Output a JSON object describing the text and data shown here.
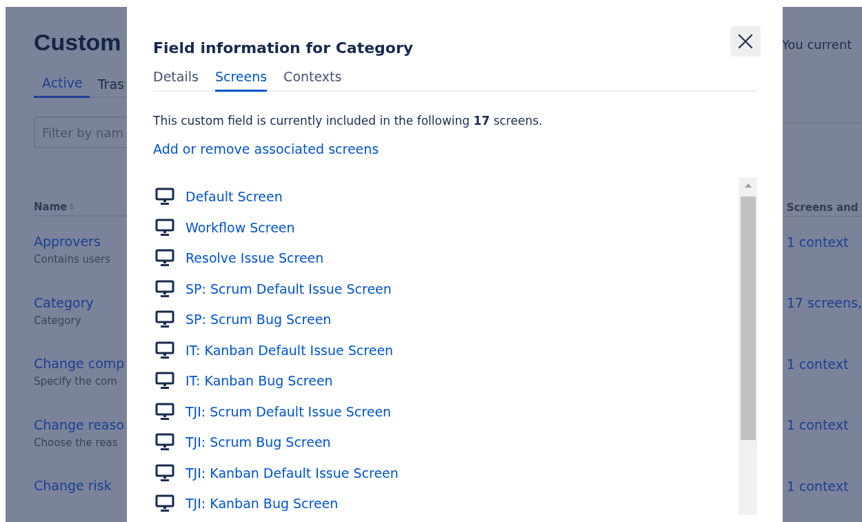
{
  "page": {
    "title": "Custom",
    "tabs": [
      {
        "label": "Active",
        "selected": true
      },
      {
        "label": "Tras",
        "selected": false
      }
    ],
    "filter": {
      "placeholder": "Filter by nam"
    },
    "notice": "You current",
    "table": {
      "columns": [
        "Name",
        "Screens and"
      ],
      "rows": [
        {
          "name": "Approvers",
          "description": "Contains users",
          "usage": "1 context"
        },
        {
          "name": "Category",
          "description": "Category",
          "usage": "17 screens,"
        },
        {
          "name": "Change comp",
          "description": "Specify the com",
          "usage": "1 context"
        },
        {
          "name": "Change reaso",
          "description": "Choose the reas",
          "usage": "1 context"
        },
        {
          "name": "Change risk",
          "usage": "1 context"
        }
      ]
    }
  },
  "dialog": {
    "title": "Field information for Category",
    "tabs": [
      {
        "label": "Details",
        "selected": false
      },
      {
        "label": "Screens",
        "selected": true
      },
      {
        "label": "Contexts",
        "selected": false
      }
    ],
    "summary": "This custom field is currently included in the following **17** screens.",
    "manage_link": "Add or remove associated screens",
    "screens": [
      "Default Screen",
      "Workflow Screen",
      "Resolve Issue Screen",
      "SP: Scrum Default Issue Screen",
      "SP: Scrum Bug Screen",
      "IT: Kanban Default Issue Screen",
      "IT: Kanban Bug Screen",
      "TJI: Scrum Default Issue Screen",
      "TJI: Scrum Bug Screen",
      "TJI: Kanban Default Issue Screen",
      "TJI: Kanban Bug Screen"
    ]
  }
}
